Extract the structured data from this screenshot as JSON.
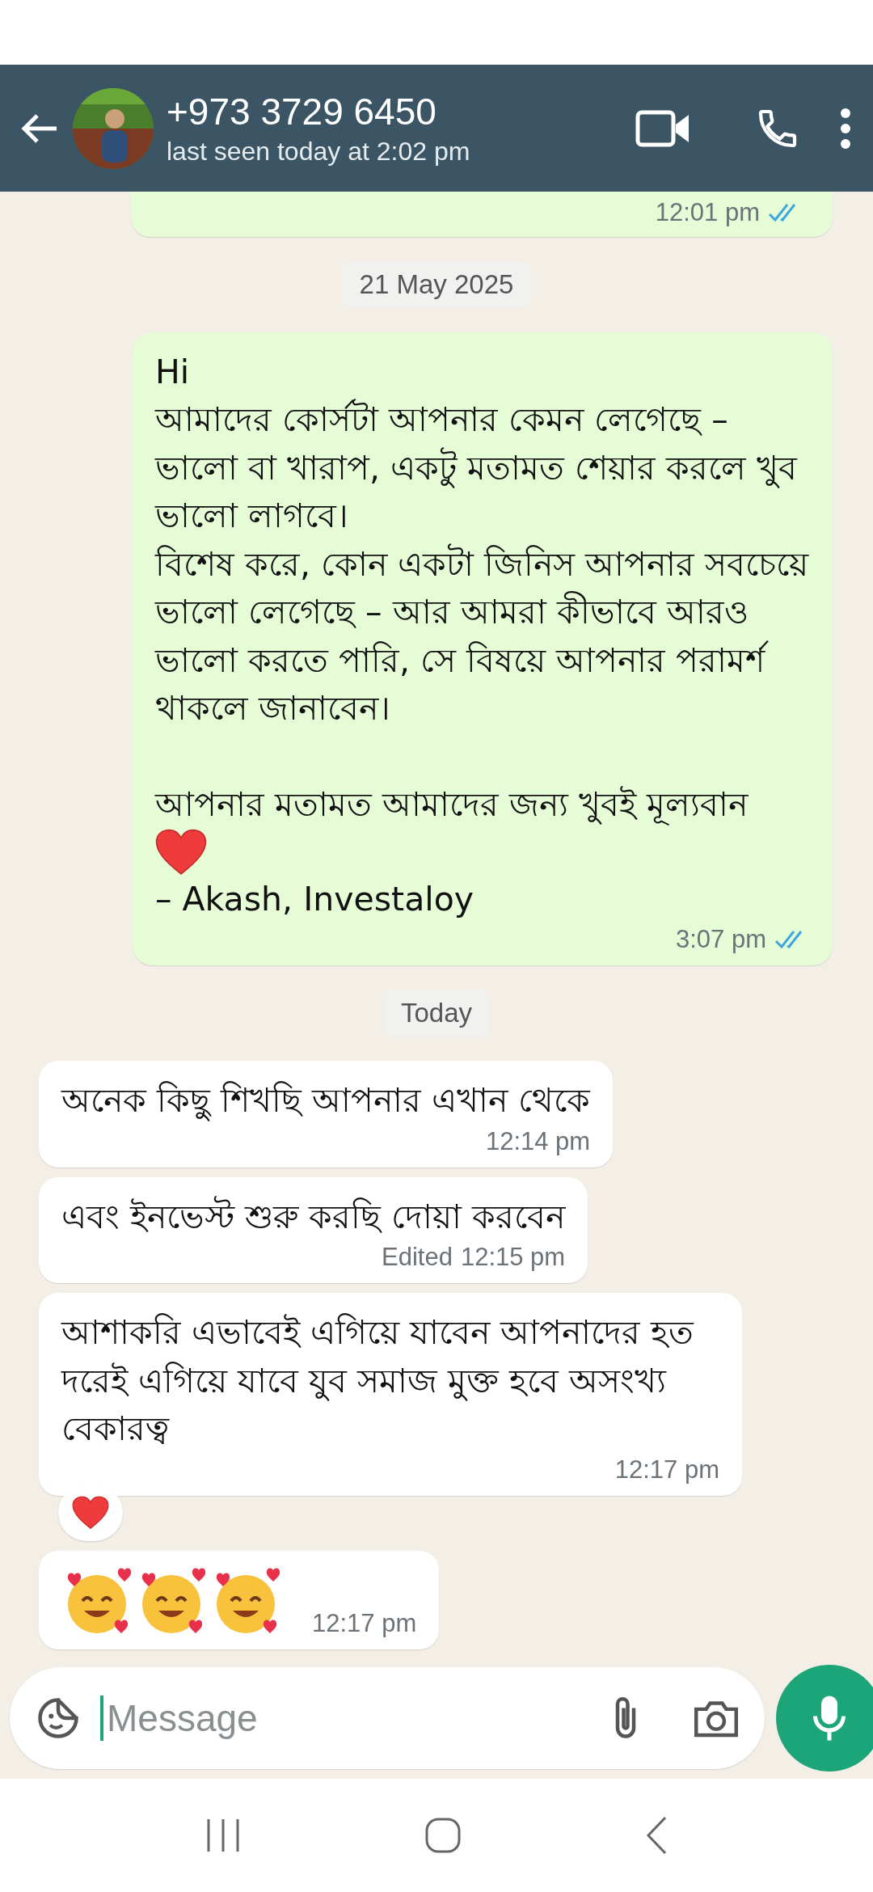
{
  "header": {
    "title": "+973 3729 6450",
    "subtitle": "last seen today at 2:02 pm"
  },
  "messages": [
    {
      "kind": "outgoing",
      "cut": true,
      "time": "12:01 pm",
      "read": true
    },
    {
      "kind": "date",
      "text": "21 May 2025"
    },
    {
      "kind": "outgoing",
      "body": [
        {
          "kind": "text",
          "text": "Hi\nআমাদের কোর্সটা আপনার কেমন লেগেছে – ভালো বা খারাপ, একটু মতামত শেয়ার করলে খুব ভালো লাগবে।\nবিশেষ করে, কোন একটা জিনিস আপনার সবচেয়ে ভালো লেগেছে – আর আমরা কীভাবে আরও ভালো করতে পারি, সে বিষয়ে আপনার পরামর্শ থাকলে জানাবেন।\n\nআপনার মতামত আমাদের জন্য খুবই মূল্যবান"
        },
        {
          "kind": "heart"
        },
        {
          "kind": "text",
          "text": "– Akash, Investaloy"
        }
      ],
      "time": "3:07 pm",
      "read": true
    },
    {
      "kind": "date",
      "text": "Today"
    },
    {
      "kind": "incoming",
      "body": [
        {
          "kind": "text",
          "text": "অনেক কিছু শিখছি আপনার এখান থেকে"
        }
      ],
      "time": "12:14 pm"
    },
    {
      "kind": "incoming",
      "body": [
        {
          "kind": "text",
          "text": "এবং ইনভেস্ট শুরু করছি দোয়া করবেন"
        }
      ],
      "edited": "Edited",
      "time": "12:15 pm"
    },
    {
      "kind": "incoming",
      "body": [
        {
          "kind": "text",
          "text": "আশাকরি এভাবেই এগিয়ে যাবেন আপনাদের হত দরেই এগিয়ে যাবে যুব সমাজ মুক্ত হবে অসংখ্য বেকারত্ব"
        }
      ],
      "time": "12:17 pm",
      "reaction": {
        "kind": "heart"
      }
    },
    {
      "kind": "incoming",
      "body": [
        {
          "kind": "face"
        },
        {
          "kind": "face"
        },
        {
          "kind": "face"
        }
      ],
      "time": "12:17 pm"
    }
  ],
  "composer": {
    "placeholder": "Message"
  }
}
